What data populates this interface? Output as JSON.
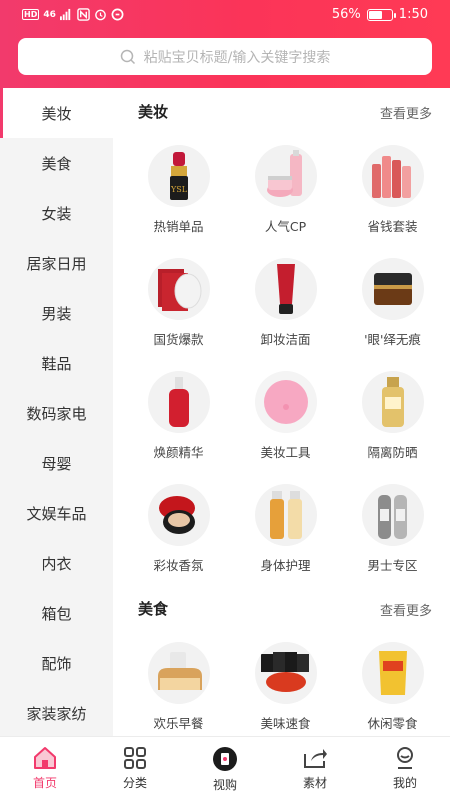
{
  "status_bar": {
    "network": "HD",
    "signal": "46",
    "battery": "56%",
    "battery_level": 0.56,
    "time": "1:50"
  },
  "search": {
    "placeholder": "粘贴宝贝标题/输入关键字搜索"
  },
  "sidebar": {
    "items": [
      {
        "label": "美妆",
        "active": true
      },
      {
        "label": "美食"
      },
      {
        "label": "女装"
      },
      {
        "label": "居家日用"
      },
      {
        "label": "男装"
      },
      {
        "label": "鞋品"
      },
      {
        "label": "数码家电"
      },
      {
        "label": "母婴"
      },
      {
        "label": "文娱车品"
      },
      {
        "label": "内衣"
      },
      {
        "label": "箱包"
      },
      {
        "label": "配饰"
      },
      {
        "label": "家装家纺"
      }
    ]
  },
  "sections": [
    {
      "title": "美妆",
      "more": "查看更多",
      "items": [
        {
          "label": "热销单品",
          "icon": "lipstick"
        },
        {
          "label": "人气CP",
          "icon": "skincare-set"
        },
        {
          "label": "省钱套装",
          "icon": "bottle-set"
        },
        {
          "label": "国货爆款",
          "icon": "face-mask"
        },
        {
          "label": "卸妆洁面",
          "icon": "cleanser-tube"
        },
        {
          "label": "'眼'绎无痕",
          "icon": "eye-cream-jar"
        },
        {
          "label": "焕颜精华",
          "icon": "serum-bottle"
        },
        {
          "label": "美妆工具",
          "icon": "cleansing-brush"
        },
        {
          "label": "隔离防晒",
          "icon": "sunscreen"
        },
        {
          "label": "彩妆香氛",
          "icon": "cushion-compact"
        },
        {
          "label": "身体护理",
          "icon": "body-lotion"
        },
        {
          "label": "男士专区",
          "icon": "men-care"
        }
      ]
    },
    {
      "title": "美食",
      "more": "查看更多",
      "items": [
        {
          "label": "欢乐早餐",
          "icon": "bread"
        },
        {
          "label": "美味速食",
          "icon": "instant-noodles"
        },
        {
          "label": "休闲零食",
          "icon": "chips-bag"
        }
      ]
    }
  ],
  "tabbar": {
    "tabs": [
      {
        "label": "首页",
        "active": true
      },
      {
        "label": "分类"
      },
      {
        "label": "视购"
      },
      {
        "label": "素材"
      },
      {
        "label": "我的"
      }
    ]
  },
  "colors": {
    "accent": "#f23a6c",
    "sidebar_bg": "#f4f4f4"
  }
}
